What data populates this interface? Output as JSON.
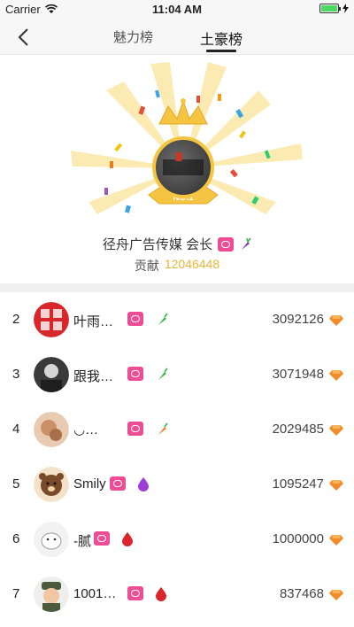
{
  "status_bar": {
    "carrier": "Carrier",
    "time": "11:04 AM"
  },
  "nav": {
    "tabs": [
      {
        "label": "魅力榜",
        "active": false
      },
      {
        "label": "土豪榜",
        "active": true
      }
    ]
  },
  "top_user": {
    "name": "径舟广告传媒 会长",
    "contribution_label": "贡献",
    "contribution_value": "12046448",
    "crown_label": "NO.1"
  },
  "ranking": [
    {
      "rank": "2",
      "name": "叶雨…",
      "score": "3092126"
    },
    {
      "rank": "3",
      "name": "跟我…",
      "score": "3071948"
    },
    {
      "rank": "4",
      "name": "◡…",
      "score": "2029485"
    },
    {
      "rank": "5",
      "name": "Smily",
      "score": "1095247"
    },
    {
      "rank": "6",
      "name": "-腻",
      "score": "1000000"
    },
    {
      "rank": "7",
      "name": "1001…",
      "score": "837468"
    }
  ],
  "colors": {
    "accent_gold": "#e8b63a",
    "badge_pink": "#ec4d95",
    "diamond_orange": "#f08c2a"
  }
}
